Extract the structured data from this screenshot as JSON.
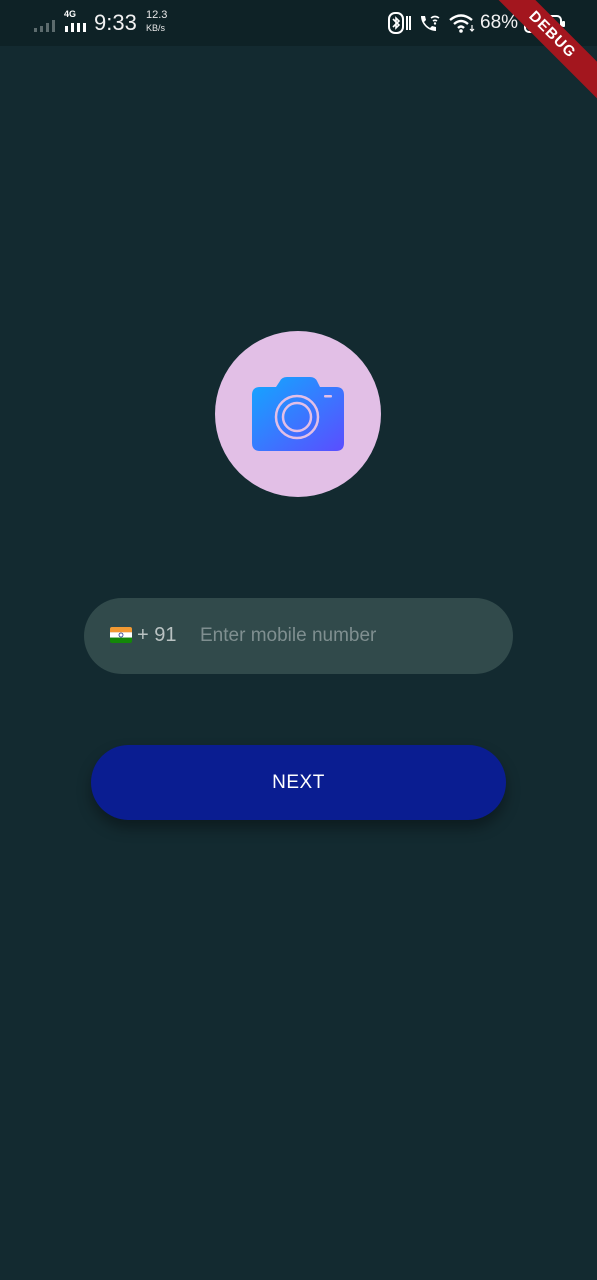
{
  "status_bar": {
    "network_type": "4G",
    "time": "9:33",
    "speed_value": "12.3",
    "speed_unit": "KB/s",
    "battery_percent": "68%",
    "icons": [
      "signal-bars-icon",
      "network-4g-icon",
      "bluetooth-icon",
      "wifi-calling-icon",
      "wifi-icon",
      "battery-icon"
    ]
  },
  "debug_banner": "DEBUG",
  "avatar": {
    "icon": "camera-icon",
    "background": "#e2bfe6",
    "icon_gradient": [
      "#12a8ff",
      "#5b4dff"
    ]
  },
  "phone": {
    "flag": "india-flag-icon",
    "country_code": "+ 91",
    "placeholder": "Enter mobile number",
    "value": ""
  },
  "actions": {
    "next_label": "NEXT"
  },
  "colors": {
    "background": "#132a30",
    "field_background": "#314a4b",
    "button_background": "#0a1d91",
    "debug_ribbon": "#a3161e"
  }
}
